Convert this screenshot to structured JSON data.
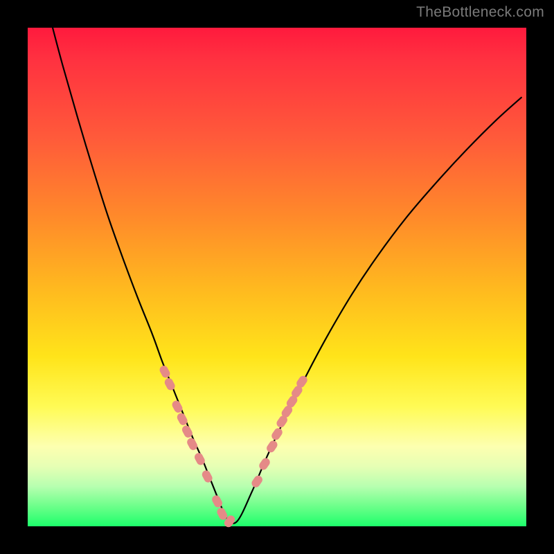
{
  "watermark": "TheBottleneck.com",
  "colors": {
    "curve": "#000000",
    "marker_fill": "#e58a87",
    "marker_stroke": "#e58a87",
    "frame": "#000000"
  },
  "chart_data": {
    "type": "line",
    "title": "",
    "xlabel": "",
    "ylabel": "",
    "xlim": [
      0,
      100
    ],
    "ylim": [
      0,
      100
    ],
    "grid": false,
    "legend": false,
    "series": [
      {
        "name": "bottleneck-curve",
        "x": [
          5,
          7,
          10,
          13,
          16,
          19,
          22,
          25,
          27,
          29,
          31,
          33,
          35,
          36,
          37,
          38,
          39,
          40,
          42,
          45,
          48,
          52,
          56,
          60,
          65,
          70,
          76,
          82,
          88,
          94,
          99
        ],
        "y": [
          100,
          92.5,
          82,
          72,
          62.5,
          54,
          46,
          38.5,
          33,
          28,
          23,
          18,
          13.5,
          11,
          8.5,
          6,
          3.5,
          1.5,
          1,
          7,
          14,
          22.5,
          30.5,
          38,
          46.5,
          54,
          62,
          69,
          75.5,
          81.5,
          86
        ]
      }
    ],
    "markers": {
      "name": "highlighted-points",
      "x": [
        27.5,
        28.5,
        30,
        31,
        32,
        33,
        34.5,
        36,
        38,
        39,
        40.5,
        46,
        47.5,
        49,
        50,
        51,
        52,
        53,
        54,
        55
      ],
      "y": [
        31,
        28.5,
        24,
        21.5,
        19,
        16.5,
        13.5,
        10,
        5,
        2.5,
        1,
        9,
        12.5,
        16,
        18.5,
        21,
        23,
        25,
        27,
        29
      ]
    }
  }
}
